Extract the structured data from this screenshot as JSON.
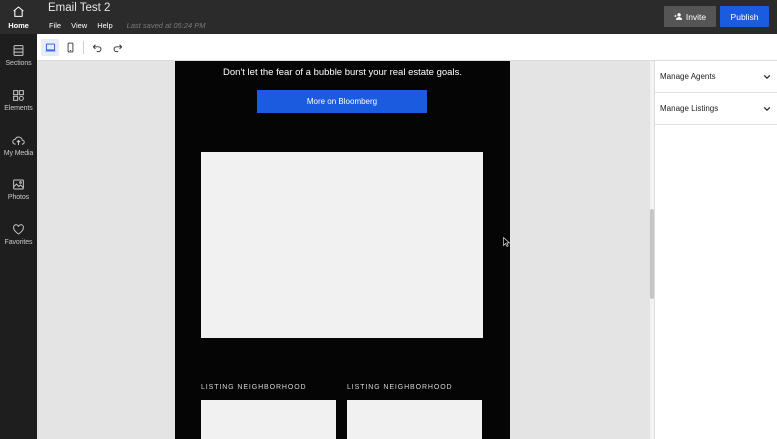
{
  "rail": {
    "home": "Home",
    "items": [
      {
        "label": "Sections",
        "icon": "sections-icon"
      },
      {
        "label": "Elements",
        "icon": "elements-icon"
      },
      {
        "label": "My Media",
        "icon": "upload-cloud-icon"
      },
      {
        "label": "Photos",
        "icon": "photo-icon"
      },
      {
        "label": "Favorites",
        "icon": "heart-icon"
      }
    ]
  },
  "header": {
    "title": "Email Test 2",
    "menu": [
      "File",
      "View",
      "Help"
    ],
    "saved": "Last saved at 05:24 PM",
    "invite": "Invite",
    "publish": "Publish"
  },
  "email": {
    "tagline": "Don't let the fear of a bubble burst your real estate goals.",
    "cta": "More on Bloomberg",
    "neighborhood_left": "LISTING NEIGHBORHOOD",
    "neighborhood_right": "LISTING NEIGHBORHOOD"
  },
  "panel": {
    "sections": [
      "Manage Agents",
      "Manage Listings"
    ]
  },
  "colors": {
    "accent": "#1a5be0",
    "topbar": "#2b2b2b",
    "rail": "#1e1e1e",
    "email_bg": "#050505"
  }
}
